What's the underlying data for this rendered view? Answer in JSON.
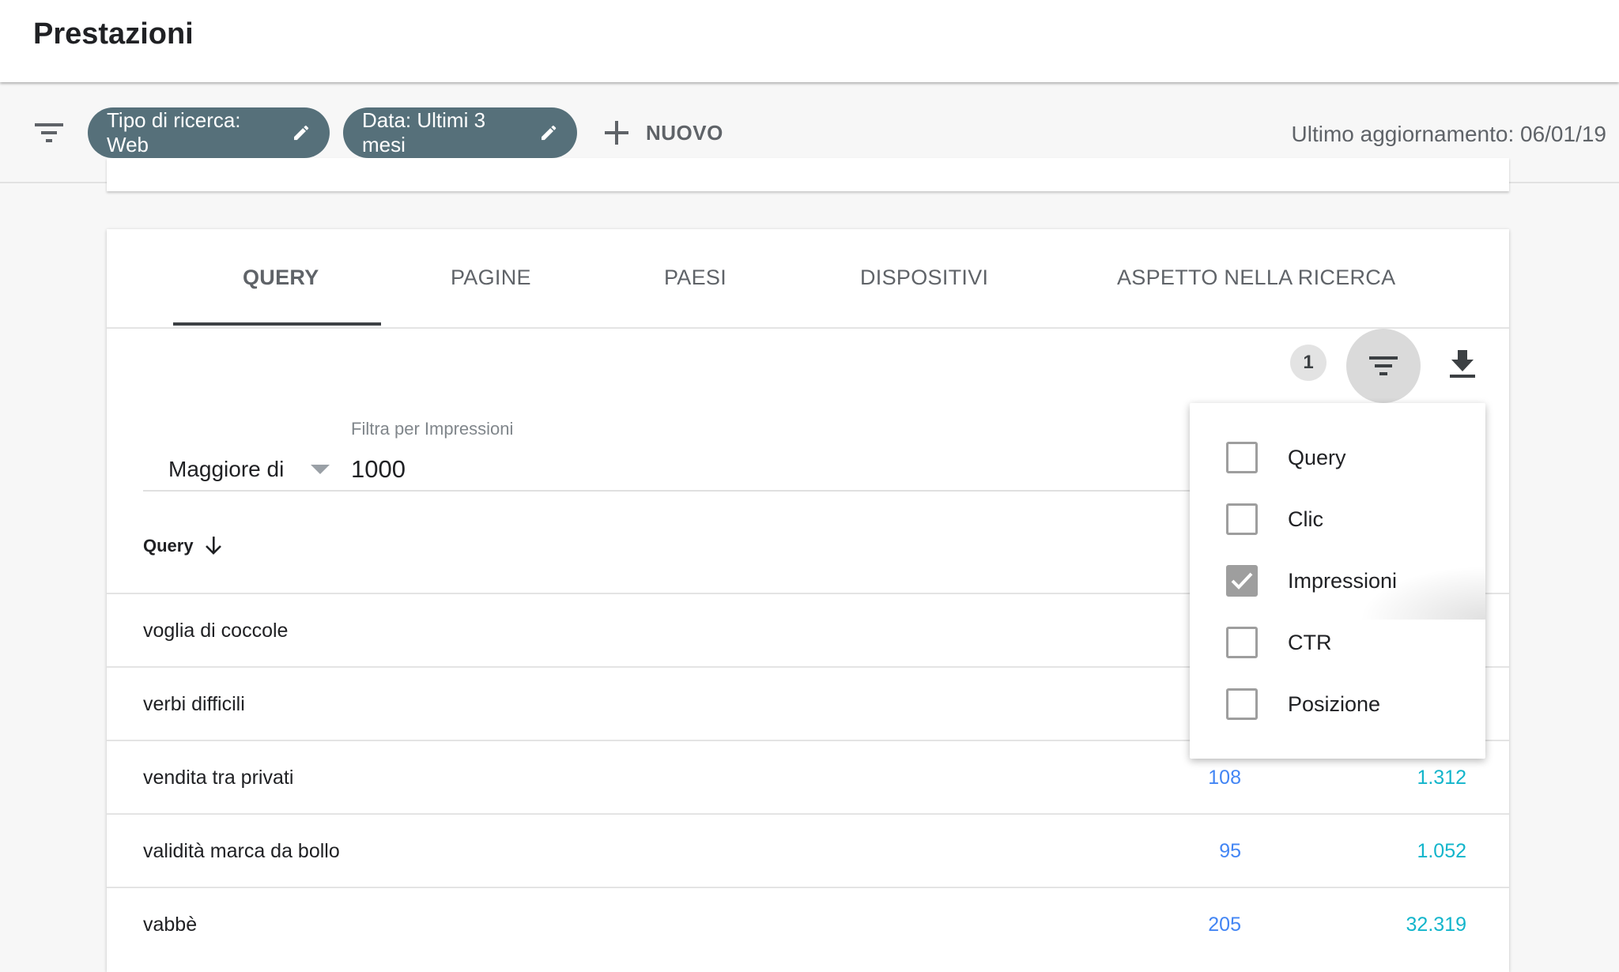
{
  "header": {
    "title": "Prestazioni"
  },
  "filters": {
    "chips": [
      {
        "label": "Tipo di ricerca: Web"
      },
      {
        "label": "Data: Ultimi 3 mesi"
      }
    ],
    "new_label": "NUOVO",
    "last_update": "Ultimo aggiornamento: 06/01/19"
  },
  "tabs": [
    {
      "label": "QUERY",
      "active": true
    },
    {
      "label": "PAGINE"
    },
    {
      "label": "PAESI"
    },
    {
      "label": "DISPOSITIVI"
    },
    {
      "label": "ASPETTO NELLA RICERCA"
    }
  ],
  "toolbar": {
    "filter_count": "1"
  },
  "filter": {
    "label": "Filtra per Impressioni",
    "condition": "Maggiore di",
    "value": "1000"
  },
  "table": {
    "column_query": "Query",
    "rows": [
      {
        "query": "voglia di coccole",
        "clicks": "",
        "impressions": ""
      },
      {
        "query": "verbi difficili",
        "clicks": "",
        "impressions": ""
      },
      {
        "query": "vendita tra privati",
        "clicks": "108",
        "impressions": "1.312"
      },
      {
        "query": "validità marca da bollo",
        "clicks": "95",
        "impressions": "1.052"
      },
      {
        "query": "vabbè",
        "clicks": "205",
        "impressions": "32.319"
      }
    ]
  },
  "filter_menu": {
    "items": [
      {
        "label": "Query",
        "checked": false
      },
      {
        "label": "Clic",
        "checked": false
      },
      {
        "label": "Impressioni",
        "checked": true
      },
      {
        "label": "CTR",
        "checked": false
      },
      {
        "label": "Posizione",
        "checked": false
      }
    ]
  },
  "colors": {
    "chip": "#56707a",
    "clicks": "#4285f4",
    "impressions": "#12b5cb"
  }
}
